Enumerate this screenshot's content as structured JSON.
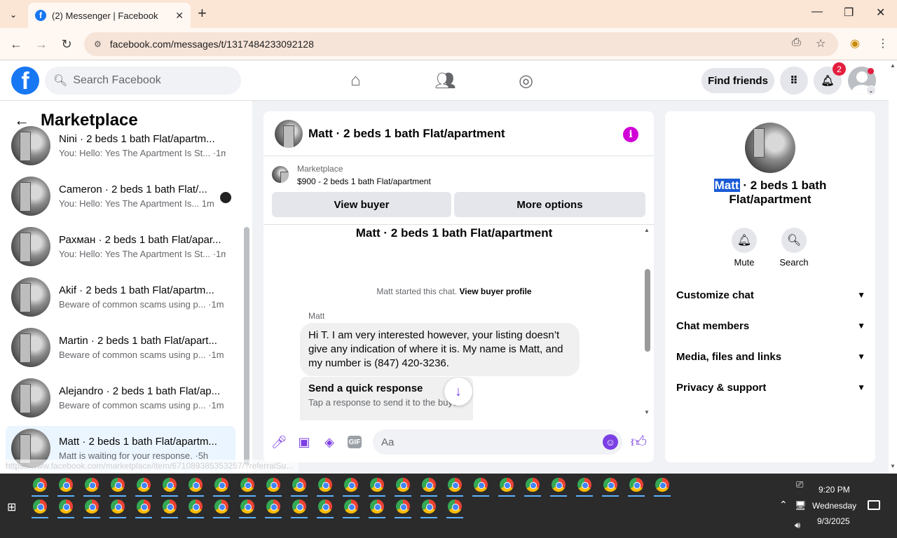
{
  "browser": {
    "tab_title": "(2) Messenger | Facebook",
    "tab_favicon": "facebook-icon",
    "url": "facebook.com/messages/t/1317484233092128",
    "status_url": "https://www.facebook.com/marketplace/item/671089385353257/?referralSu..."
  },
  "header": {
    "search_placeholder": "Search Facebook",
    "find_friends": "Find friends",
    "notification_count": "2"
  },
  "left_panel": {
    "title": "Marketplace",
    "conversations": [
      {
        "name": "Nini · 2 beds 1 bath Flat/apartm...",
        "preview": "You: Hello: Yes The Apartment Is St... ·1m"
      },
      {
        "name": "Cameron · 2 beds 1 bath Flat/...",
        "preview": "You: Hello: Yes The Apartment Is... 1m"
      },
      {
        "name": "Рахман · 2 beds 1 bath Flat/apar...",
        "preview": "You: Hello: Yes The Apartment Is St... ·1m"
      },
      {
        "name": "Akif · 2 beds 1 bath Flat/apartm...",
        "preview": "Beware of common scams using p... ·1m"
      },
      {
        "name": "Martin · 2 beds 1 bath Flat/apart...",
        "preview": "Beware of common scams using p... ·1m"
      },
      {
        "name": "Alejandro · 2 beds 1 bath Flat/ap...",
        "preview": "Beware of common scams using p... ·1m"
      },
      {
        "name": "Matt · 2 beds 1 bath Flat/apartm...",
        "preview": "Matt is waiting for your response. ·5h"
      }
    ]
  },
  "chat": {
    "title": "Matt · 2 beds 1 bath Flat/apartment",
    "marketplace_label": "Marketplace",
    "listing": "$900 - 2 beds 1 bath Flat/apartment",
    "view_buyer": "View buyer",
    "more_options": "More options",
    "conversation_title": "Matt · 2 beds 1 bath Flat/apartment",
    "started_text": "Matt started this chat.",
    "view_buyer_profile": "View buyer profile",
    "sender": "Matt",
    "message": "Hi T.  I am very interested however, your listing doesn’t give any indication of where it is. My name is Matt, and my number is (847) 420-3236.",
    "quick_title": "Send a quick response",
    "quick_sub": "Tap a response to send it to the buyer",
    "composer_placeholder": "Aa"
  },
  "right_panel": {
    "name_highlight": "Matt",
    "name_rest": " · 2 beds 1 bath Flat/apartment",
    "mute": "Mute",
    "search": "Search",
    "sections": [
      "Customize chat",
      "Chat members",
      "Media, files and links",
      "Privacy & support"
    ]
  },
  "taskbar": {
    "time": "9:20 PM",
    "day": "Wednesday",
    "date": "9/3/2025"
  },
  "colors": {
    "facebook_blue": "#1877f2",
    "messenger_purple": "#7b3fe4",
    "info_magenta": "#d100d6",
    "badge_red": "#e41e3f"
  }
}
